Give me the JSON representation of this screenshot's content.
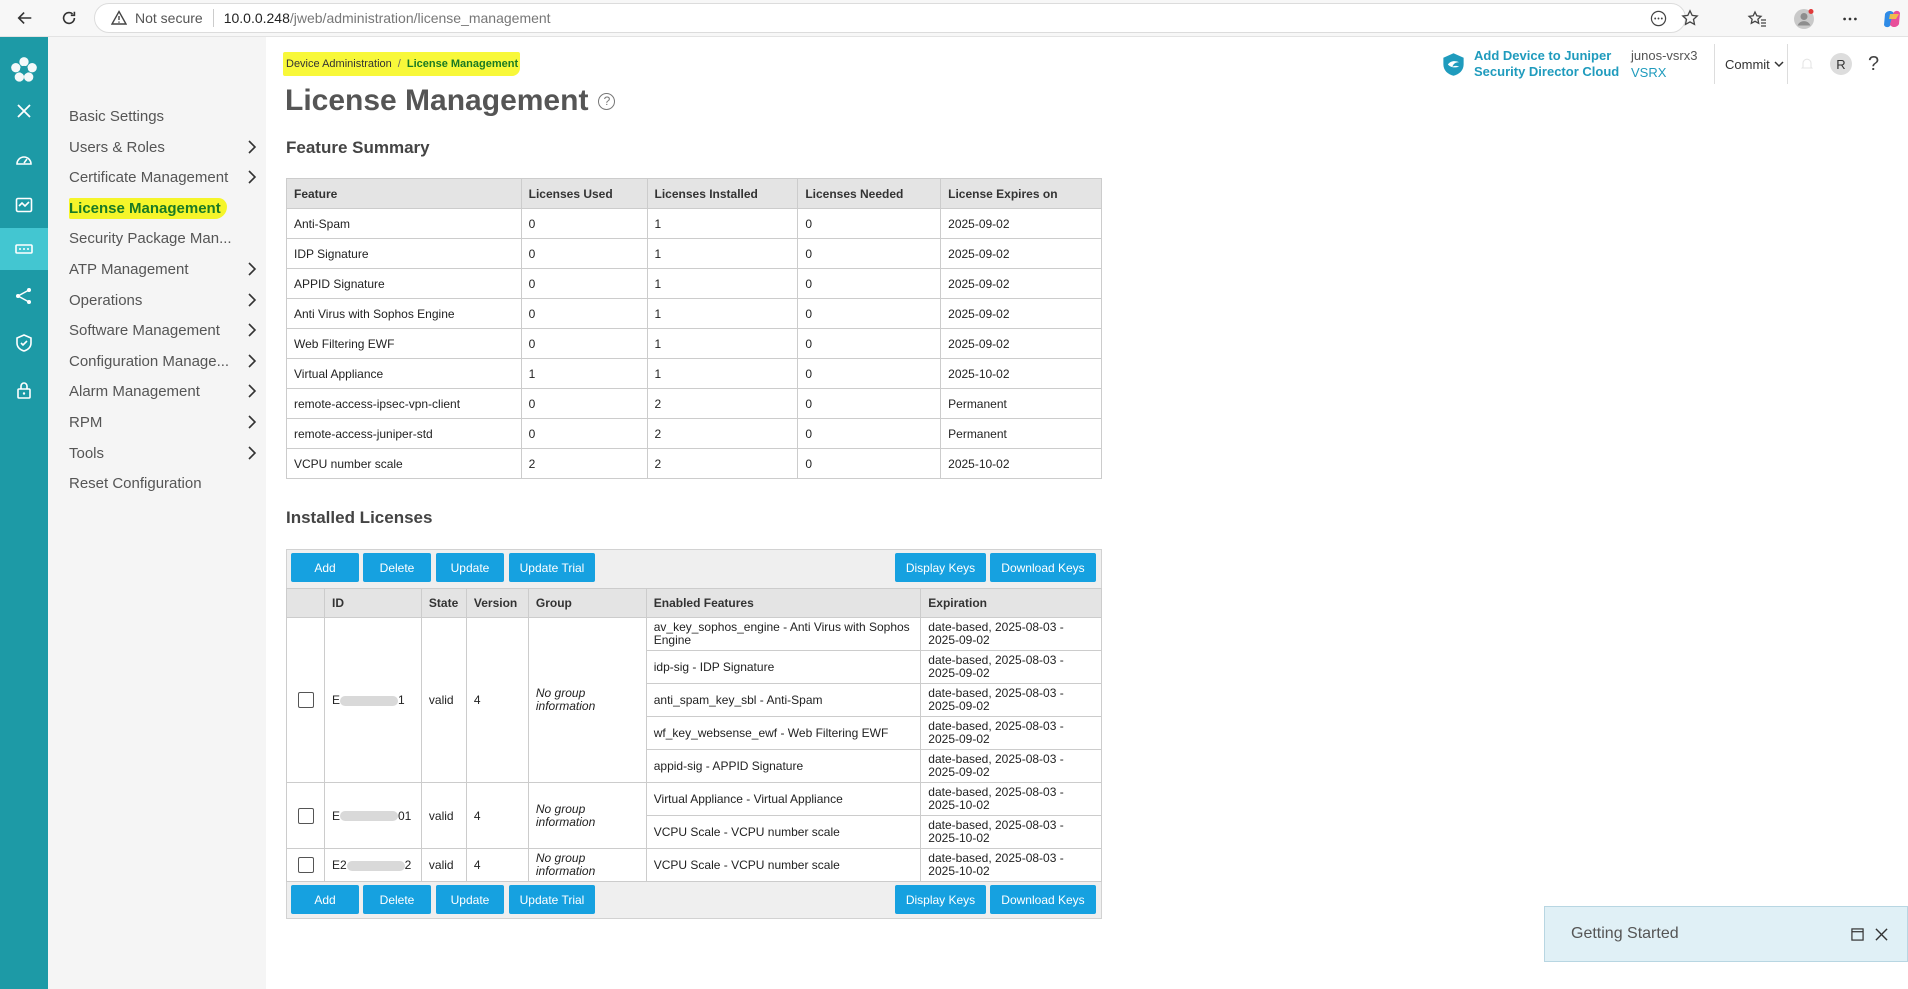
{
  "browser": {
    "security": "Not secure",
    "url_host": "10.0.0.248",
    "url_path": "/jweb/administration/license_management"
  },
  "breadcrumb": {
    "parent": "Device Administration",
    "separator": "/",
    "current": "License Management"
  },
  "page_title": "License Management",
  "help_glyph": "?",
  "header": {
    "sdc_line1": "Add Device to Juniper",
    "sdc_line2": "Security Director Cloud",
    "device_name": "junos-vsrx3",
    "device_model": "VSRX",
    "commit_label": "Commit",
    "user_initial": "R",
    "help": "?"
  },
  "menu": {
    "items": [
      {
        "label": "Basic Settings",
        "has_chevron": false
      },
      {
        "label": "Users & Roles",
        "has_chevron": true
      },
      {
        "label": "Certificate Management",
        "has_chevron": true
      },
      {
        "label": "License Management",
        "has_chevron": false,
        "active": true
      },
      {
        "label": "Security Package Man...",
        "has_chevron": false
      },
      {
        "label": "ATP Management",
        "has_chevron": true
      },
      {
        "label": "Operations",
        "has_chevron": true
      },
      {
        "label": "Software Management",
        "has_chevron": true
      },
      {
        "label": "Configuration Manage...",
        "has_chevron": true
      },
      {
        "label": "Alarm Management",
        "has_chevron": true
      },
      {
        "label": "RPM",
        "has_chevron": true
      },
      {
        "label": "Tools",
        "has_chevron": true
      },
      {
        "label": "Reset Configuration",
        "has_chevron": false
      }
    ]
  },
  "feature_summary": {
    "title": "Feature Summary",
    "columns": [
      "Feature",
      "Licenses Used",
      "Licenses Installed",
      "Licenses Needed",
      "License Expires on"
    ],
    "rows": [
      [
        "Anti-Spam",
        "0",
        "1",
        "0",
        "2025-09-02"
      ],
      [
        "IDP Signature",
        "0",
        "1",
        "0",
        "2025-09-02"
      ],
      [
        "APPID Signature",
        "0",
        "1",
        "0",
        "2025-09-02"
      ],
      [
        "Anti Virus with Sophos Engine",
        "0",
        "1",
        "0",
        "2025-09-02"
      ],
      [
        "Web Filtering EWF",
        "0",
        "1",
        "0",
        "2025-09-02"
      ],
      [
        "Virtual Appliance",
        "1",
        "1",
        "0",
        "2025-10-02"
      ],
      [
        "remote-access-ipsec-vpn-client",
        "0",
        "2",
        "0",
        "Permanent"
      ],
      [
        "remote-access-juniper-std",
        "0",
        "2",
        "0",
        "Permanent"
      ],
      [
        "VCPU number scale",
        "2",
        "2",
        "0",
        "2025-10-02"
      ]
    ]
  },
  "installed": {
    "title": "Installed Licenses",
    "buttons": {
      "add": "Add",
      "delete": "Delete",
      "update": "Update",
      "update_trial": "Update Trial",
      "display_keys": "Display Keys",
      "download_keys": "Download Keys"
    },
    "columns": {
      "id": "ID",
      "state": "State",
      "version": "Version",
      "group": "Group",
      "enabled": "Enabled Features",
      "expiration": "Expiration"
    },
    "licenses": [
      {
        "id_start": "E",
        "id_end": "1",
        "state": "valid",
        "version": "4",
        "group": "No group information",
        "features": [
          {
            "name": "av_key_sophos_engine - Anti Virus with Sophos Engine",
            "expiration": "date-based, 2025-08-03 - 2025-09-02"
          },
          {
            "name": "idp-sig - IDP Signature",
            "expiration": "date-based, 2025-08-03 - 2025-09-02"
          },
          {
            "name": "anti_spam_key_sbl - Anti-Spam",
            "expiration": "date-based, 2025-08-03 - 2025-09-02"
          },
          {
            "name": "wf_key_websense_ewf - Web Filtering EWF",
            "expiration": "date-based, 2025-08-03 - 2025-09-02"
          },
          {
            "name": "appid-sig - APPID Signature",
            "expiration": "date-based, 2025-08-03 - 2025-09-02"
          }
        ]
      },
      {
        "id_start": "E",
        "id_end": "01",
        "state": "valid",
        "version": "4",
        "group": "No group information",
        "features": [
          {
            "name": "Virtual Appliance - Virtual Appliance",
            "expiration": "date-based, 2025-08-03 - 2025-10-02"
          },
          {
            "name": "VCPU Scale - VCPU number scale",
            "expiration": "date-based, 2025-08-03 - 2025-10-02"
          }
        ]
      },
      {
        "id_start": "E2",
        "id_end": "2",
        "state": "valid",
        "version": "4",
        "group": "No group information",
        "features": [
          {
            "name": "VCPU Scale - VCPU number scale",
            "expiration": "date-based, 2025-08-03 - 2025-10-02"
          }
        ]
      }
    ]
  },
  "getting_started": {
    "title": "Getting Started"
  },
  "colors": {
    "rail": "#1d9aa6",
    "rail_active": "#43c6d1",
    "button": "#16a1e0",
    "highlight": "#f5f52a",
    "brand_text": "#1f9bbd"
  },
  "icons": {
    "rail": [
      "juniper-flower-icon",
      "close-icon",
      "dashboard-icon",
      "monitor-icon",
      "device-admin-icon",
      "network-icon",
      "security-shield-icon",
      "lock-icon"
    ]
  }
}
